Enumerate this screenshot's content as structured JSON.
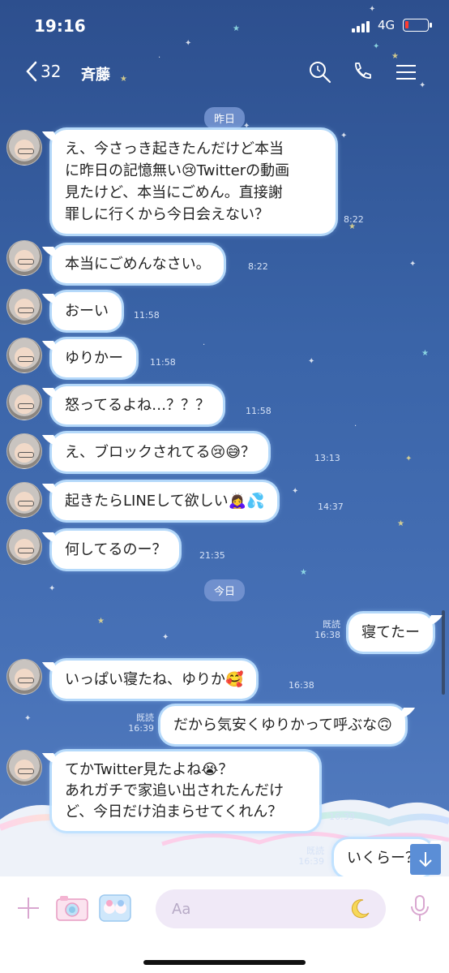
{
  "status_bar": {
    "time": "19:16",
    "network": "4G"
  },
  "header": {
    "unread_count": "32",
    "contact_name": "斉藤"
  },
  "dates": {
    "yesterday": "昨日",
    "today": "今日"
  },
  "messages": [
    {
      "text_lines": [
        "え、今さっき起きたんだけど本当",
        "に昨日の記憶無い😢Twitterの動画",
        "見たけど、本当にごめん。直接謝",
        "罪しに行くから今日会えない？"
      ],
      "time": "8:22"
    },
    {
      "text": "本当にごめんなさい。",
      "time": "8:22"
    },
    {
      "text": "おーい",
      "time": "11:58"
    },
    {
      "text": "ゆりかー",
      "time": "11:58"
    },
    {
      "text": "怒ってるよね…？？？",
      "time": "11:58"
    },
    {
      "text": "え、ブロックされてる😢😅？",
      "time": "13:13"
    },
    {
      "text": "起きたらLINEして欲しい🙇‍♀️💦",
      "time": "14:37"
    },
    {
      "text": "何してるのー？",
      "time": "21:35"
    },
    {
      "text": "寝てたー",
      "time": "16:38",
      "read": "既読"
    },
    {
      "text": "いっぱい寝たね、ゆりか🥰",
      "time": "16:38"
    },
    {
      "text": "だから気安くゆりかって呼ぶな🙃",
      "time": "16:39",
      "read": "既読"
    },
    {
      "text_lines": [
        "てかTwitter見たよね😭？",
        "あれガチで家追い出されたんだけ",
        "ど、今日だけ泊まらせてくれん？"
      ],
      "time": "16:39"
    },
    {
      "text": "いくらー？",
      "time": "16:39",
      "read": "既読"
    }
  ],
  "input": {
    "placeholder": "Aa"
  },
  "colors": {
    "background": "#3a64a8",
    "bubble": "#ffffff",
    "input_bar": "#ffffff"
  }
}
